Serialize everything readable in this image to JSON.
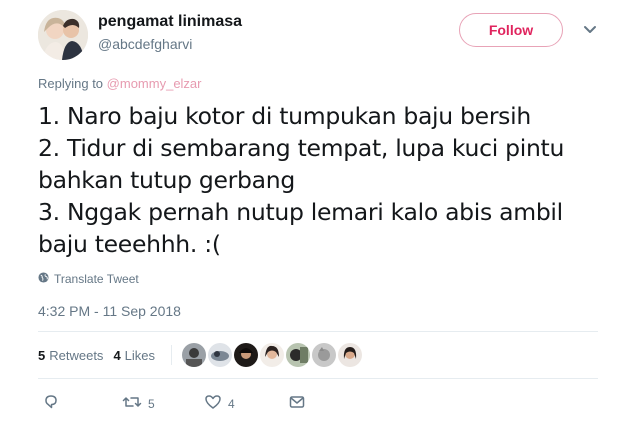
{
  "author": {
    "display_name": "pengamat linimasa",
    "handle": "@abcdefgharvi"
  },
  "follow_button_label": "Follow",
  "reply_context": {
    "prefix": "Replying to",
    "mention": "@mommy_elzar"
  },
  "tweet": {
    "lines": [
      "1. Naro baju kotor di tumpukan baju bersih",
      "2. Tidur di sembarang tempat, lupa kuci pintu",
      "bahkan tutup gerbang",
      "3. Nggak pernah nutup lemari kalo abis ambil",
      "baju teeehhh. :("
    ]
  },
  "translate_label": "Translate Tweet",
  "timestamp": "4:32 PM - 11 Sep 2018",
  "stats": {
    "retweets_count": "5",
    "retweets_label": "Retweets",
    "likes_count": "4",
    "likes_label": "Likes"
  },
  "actions": {
    "reply_icon": "reply-icon",
    "retweet_icon": "retweet-icon",
    "retweet_count": "5",
    "like_icon": "heart-icon",
    "like_count": "4",
    "dm_icon": "envelope-icon"
  },
  "colors": {
    "text_primary": "#14171a",
    "text_secondary": "#657786",
    "follow_accent": "#e0245e",
    "mention_accent": "#e79bb0",
    "divider": "#e6ecf0"
  }
}
